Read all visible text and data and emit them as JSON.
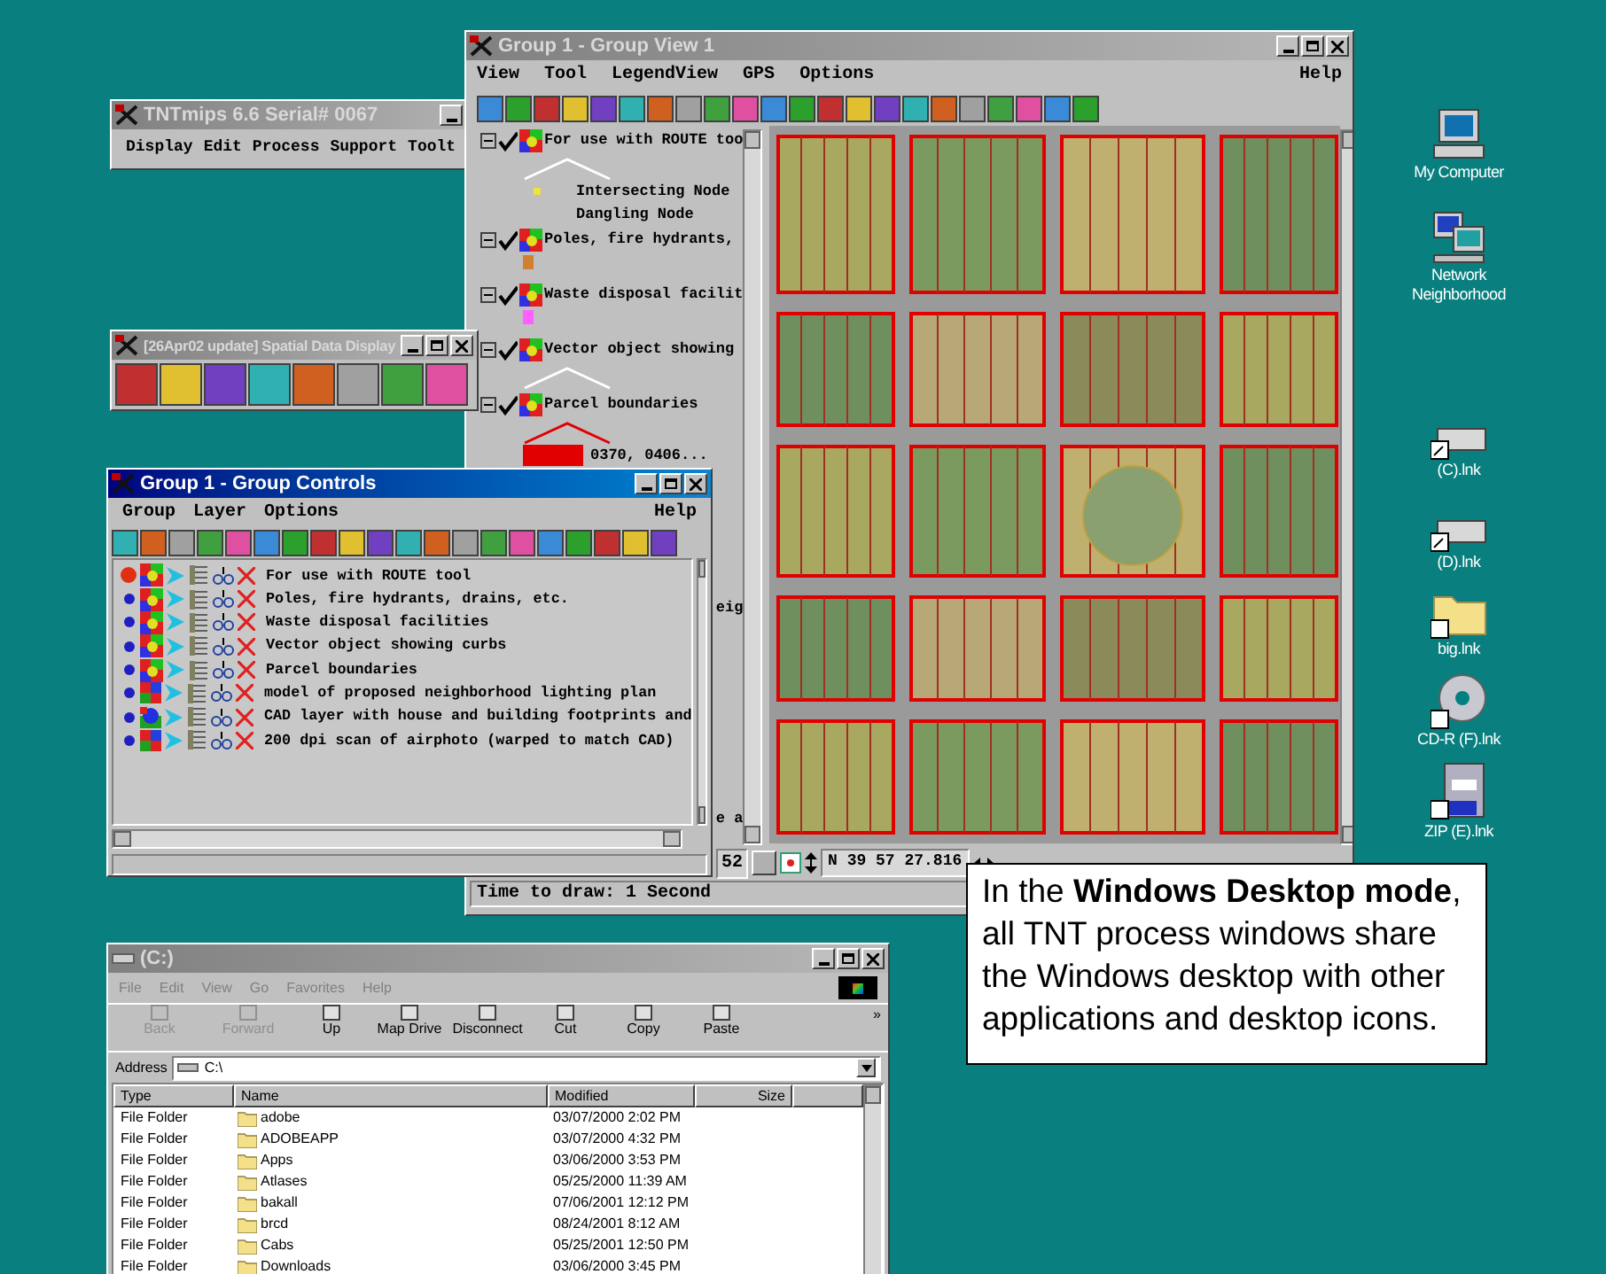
{
  "tntmips": {
    "title": "TNTmips 6.6  Serial# 0067",
    "menu": [
      "Display",
      "Edit",
      "Process",
      "Support",
      "Toolt"
    ]
  },
  "spatial_display": {
    "title": "[26Apr02 update] Spatial Data Display"
  },
  "group_view": {
    "title": "Group 1 - Group View 1",
    "menu": [
      "View",
      "Tool",
      "LegendView",
      "GPS",
      "Options"
    ],
    "help": "Help",
    "legend": [
      {
        "label": "For use with ROUTE too",
        "checked": true,
        "kind": "line",
        "color": "#ffffff",
        "entries": [
          "Intersecting Node",
          "Dangling Node"
        ]
      },
      {
        "label": "Poles, fire hydrants,",
        "checked": true,
        "kind": "point",
        "color": "#d08030"
      },
      {
        "label": "Waste disposal facilit",
        "checked": true,
        "kind": "point",
        "color": "#ff60ff"
      },
      {
        "label": "Vector object showing",
        "checked": true,
        "kind": "line",
        "color": "#ffffff"
      },
      {
        "label": "Parcel boundaries",
        "checked": true,
        "kind": "polygon",
        "color": "#e00000",
        "entries": [
          "0370, 0406..."
        ]
      }
    ],
    "fragments": [
      "eig",
      "e a"
    ],
    "status_value": "52",
    "coordinate": "N 39 57 27.816",
    "status": "Time to draw: 1 Second"
  },
  "group_controls": {
    "title": "Group 1 - Group Controls",
    "menu": [
      "Group",
      "Layer",
      "Options"
    ],
    "help": "Help",
    "layers": [
      {
        "label": "For use with ROUTE tool",
        "selected": true,
        "kind": "vector"
      },
      {
        "label": "Poles, fire hydrants, drains, etc.",
        "selected": false,
        "kind": "vector"
      },
      {
        "label": "Waste disposal facilities",
        "selected": false,
        "kind": "vector"
      },
      {
        "label": "Vector object showing curbs",
        "selected": false,
        "kind": "vector"
      },
      {
        "label": "Parcel boundaries",
        "selected": false,
        "kind": "vector"
      },
      {
        "label": "model of proposed neighborhood lighting plan",
        "selected": false,
        "kind": "raster"
      },
      {
        "label": "CAD layer with house and building footprints and",
        "selected": false,
        "kind": "cad"
      },
      {
        "label": "200 dpi scan of airphoto (warped to match CAD)",
        "selected": false,
        "kind": "raster"
      }
    ]
  },
  "explorer": {
    "title": "(C:)",
    "menu": [
      "File",
      "Edit",
      "View",
      "Go",
      "Favorites",
      "Help"
    ],
    "toolbar": [
      {
        "label": "Back",
        "disabled": true
      },
      {
        "label": "Forward",
        "disabled": true
      },
      {
        "label": "Up",
        "disabled": false
      },
      {
        "label": "Map Drive",
        "disabled": false
      },
      {
        "label": "Disconnect",
        "disabled": false
      },
      {
        "label": "Cut",
        "disabled": false
      },
      {
        "label": "Copy",
        "disabled": false
      },
      {
        "label": "Paste",
        "disabled": false
      }
    ],
    "more": "»",
    "address_label": "Address",
    "address": "C:\\",
    "columns": [
      "Type",
      "Name",
      "Modified",
      "Size"
    ],
    "rows": [
      {
        "type": "File Folder",
        "name": "adobe",
        "modified": "03/07/2000 2:02 PM"
      },
      {
        "type": "File Folder",
        "name": "ADOBEAPP",
        "modified": "03/07/2000 4:32 PM"
      },
      {
        "type": "File Folder",
        "name": "Apps",
        "modified": "03/06/2000 3:53 PM"
      },
      {
        "type": "File Folder",
        "name": "Atlases",
        "modified": "05/25/2000 11:39 AM"
      },
      {
        "type": "File Folder",
        "name": "bakall",
        "modified": "07/06/2001 12:12 PM"
      },
      {
        "type": "File Folder",
        "name": "brcd",
        "modified": "08/24/2001 8:12 AM"
      },
      {
        "type": "File Folder",
        "name": "Cabs",
        "modified": "05/25/2001 12:50 PM"
      },
      {
        "type": "File Folder",
        "name": "Downloads",
        "modified": "03/06/2000 3:45 PM"
      }
    ]
  },
  "callout": "In the **Windows Desktop mode**, all TNT process windows share the Windows desktop with other applications and desktop icons.",
  "desktop_icons": [
    {
      "label": "My Computer",
      "kind": "computer"
    },
    {
      "label": "Network Neighborhood",
      "kind": "network"
    },
    {
      "label": "(C).lnk",
      "kind": "drive"
    },
    {
      "label": "(D).lnk",
      "kind": "drive"
    },
    {
      "label": "big.lnk",
      "kind": "folder"
    },
    {
      "label": "CD-R (F).lnk",
      "kind": "cdrom"
    },
    {
      "label": "ZIP (E).lnk",
      "kind": "zip"
    }
  ]
}
